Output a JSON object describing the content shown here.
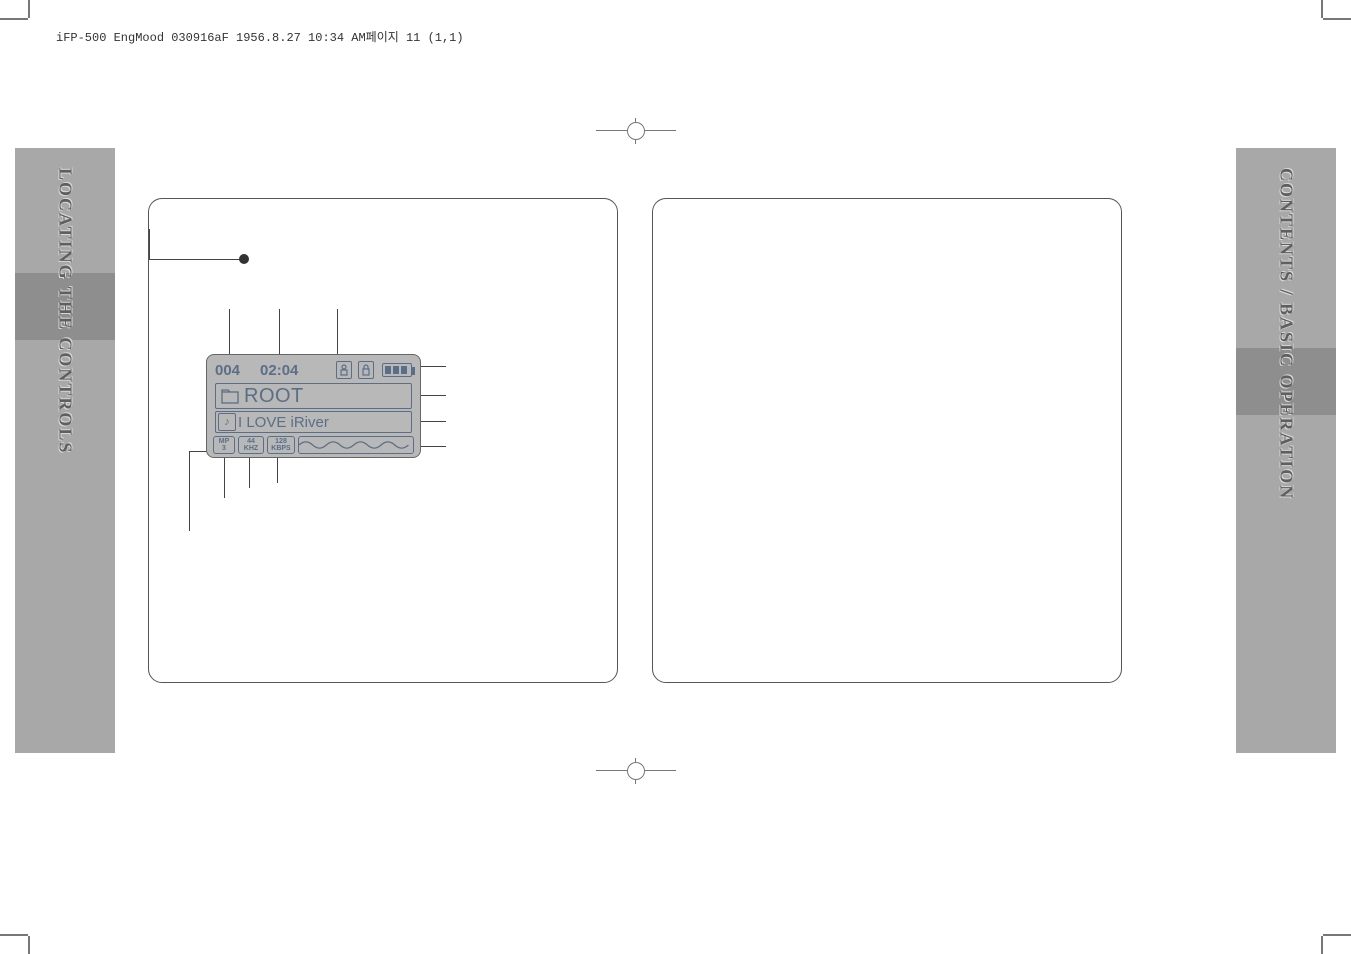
{
  "header_meta": "iFP-500 EngMood 030916aF  1956.8.27 10:34 AM페이지 11 (1,1)",
  "left_tab_label": "LOCATING THE CONTROLS",
  "right_tab_label": "CONTENTS / BASIC OPERATION",
  "lcd": {
    "track_number": "004",
    "elapsed_time": "02:04",
    "folder_name": "ROOT",
    "track_title": "I LOVE iRiver",
    "format_top": "MP",
    "format_bottom": "3",
    "sample_top": "44",
    "sample_bottom": "KHZ",
    "bitrate_top": "128",
    "bitrate_bottom": "KBPS"
  }
}
